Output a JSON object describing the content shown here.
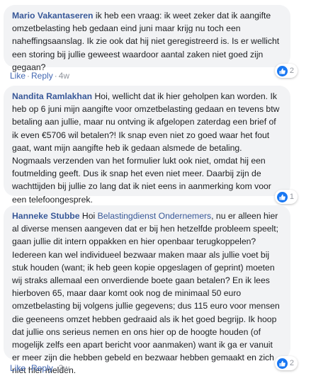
{
  "comments": [
    {
      "author": "Mario Vakantaseren",
      "text": "ik heb een vraag: ik weet zeker dat ik aangifte omzetbelasting heb gedaan eind juni maar krijg nu toch een naheffingsaanslag. Ik zie ook dat hij niet geregistreerd is. Is er wellicht een storing bij jullie geweest waardoor aantal zaken niet goed zijn gegaan?",
      "like_label": "Like",
      "reply_label": "Reply",
      "separator": "·",
      "time": "4w",
      "reaction_count": "2"
    },
    {
      "author": "Nandita Ramlakhan",
      "text": "Hoi, wellicht dat ik hier geholpen kan worden. Ik heb op 6 juni mijn aangifte voor omzetbelasting gedaan en tevens btw betaling aan jullie, maar nu ontving ik afgelopen zaterdag een brief of ik even €5706 wil betalen?! Ik snap even niet zo goed waar het fout gaat, want mijn aangifte heb ik gedaan alsmede de betaling. Nogmaals verzenden van het formulier lukt ook niet, omdat hij een foutmelding geeft. Dus ik snap het even niet meer. Daarbij zijn de wachttijden bij jullie zo lang dat ik niet eens in aanmerking kom voor een telefoongesprek.",
      "reaction_count": "1"
    },
    {
      "author": "Hanneke Stubbe",
      "text_prefix": "Hoi",
      "mention": "Belastingdienst Ondernemers",
      "text": ", nu er alleen hier al diverse mensen aangeven dat er bij hen hetzelfde probleem speelt; gaan jullie dit intern oppakken en hier openbaar terugkoppelen? Iedereen kan wel individueel bezwaar maken maar als jullie voet bij stuk houden (want; ik heb geen kopie opgeslagen of geprint) moeten wij straks allemaal een onverdiende boete gaan betalen? En ik lees hierboven 65, maar daar komt ook nog de minimaal 50 euro omzetbelasting bij volgens jullie gegevens; dus 115 euro voor mensen die geeneens omzet hebben gedraaid als ik het goed begrijp. Ik hoop dat jullie ons serieus nemen en ons hier op de hoogte houden (of mogelijk zelfs een apart bericht voor aanmaken) want ik ga er vanuit er meer zijn die hebben gebeld en bezwaar hebben gemaakt en zich niet hier melden.",
      "like_label": "Like",
      "reply_label": "Reply",
      "separator": "·",
      "time": "3w",
      "reaction_count": "2"
    }
  ],
  "colors": {
    "author": "#385898",
    "action_link": "#4267b2",
    "bubble_bg": "#f2f3f5",
    "like_badge": "#1877f2"
  },
  "icons": {
    "reaction": "thumbs-up-icon"
  }
}
